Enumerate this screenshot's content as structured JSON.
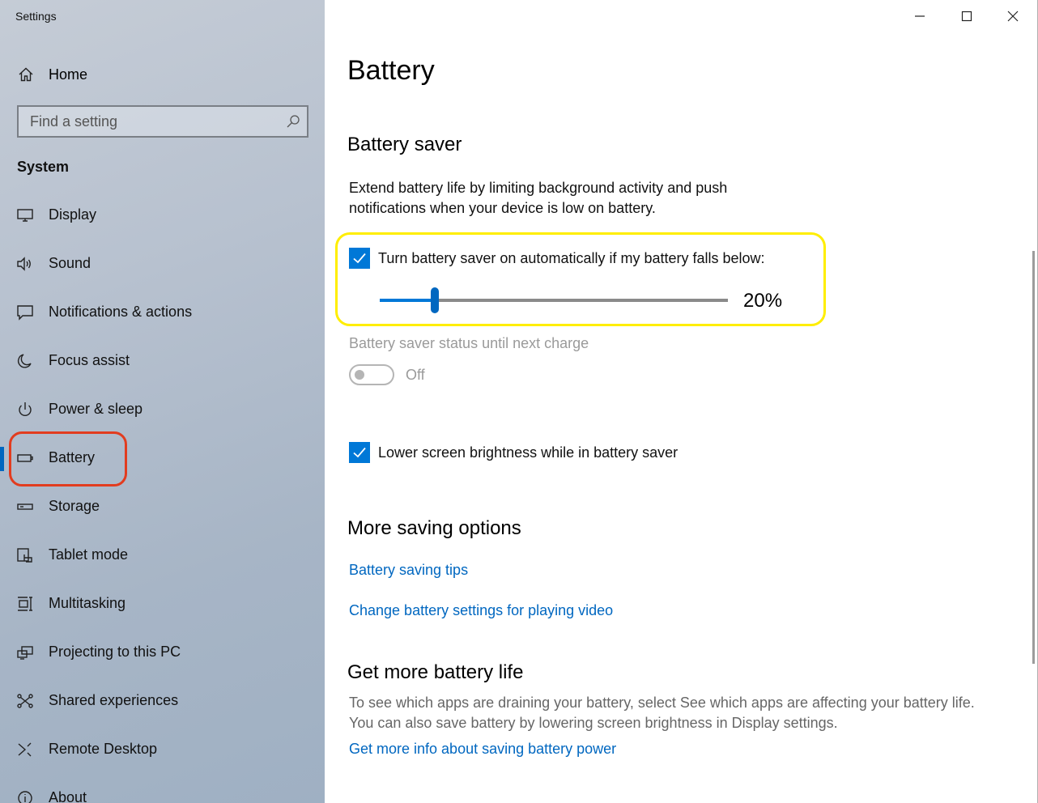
{
  "app": {
    "title": "Settings"
  },
  "sidebar": {
    "home_label": "Home",
    "search_placeholder": "Find a setting",
    "group_header": "System",
    "items": [
      {
        "label": "Display",
        "icon": "monitor-icon"
      },
      {
        "label": "Sound",
        "icon": "speaker-icon"
      },
      {
        "label": "Notifications & actions",
        "icon": "notification-icon"
      },
      {
        "label": "Focus assist",
        "icon": "moon-icon"
      },
      {
        "label": "Power & sleep",
        "icon": "power-icon"
      },
      {
        "label": "Battery",
        "icon": "battery-icon",
        "selected": true
      },
      {
        "label": "Storage",
        "icon": "storage-icon"
      },
      {
        "label": "Tablet mode",
        "icon": "tablet-mode-icon"
      },
      {
        "label": "Multitasking",
        "icon": "multitasking-icon"
      },
      {
        "label": "Projecting to this PC",
        "icon": "projecting-icon"
      },
      {
        "label": "Shared experiences",
        "icon": "shared-experiences-icon"
      },
      {
        "label": "Remote Desktop",
        "icon": "remote-desktop-icon"
      },
      {
        "label": "About",
        "icon": "info-icon"
      }
    ]
  },
  "main": {
    "title": "Battery",
    "battery_saver": {
      "heading": "Battery saver",
      "description_line1": "Extend battery life by limiting background activity and push",
      "description_line2": "notifications when your device is low on battery.",
      "auto_checkbox_label": "Turn battery saver on automatically if my battery falls below:",
      "auto_checked": true,
      "threshold_percent": 20,
      "threshold_label": "20%",
      "status_label": "Battery saver status until next charge",
      "status_toggle_label": "Off",
      "status_on": false,
      "brightness_checkbox_label": "Lower screen brightness while in battery saver",
      "brightness_checked": true
    },
    "more_saving": {
      "heading": "More saving options",
      "links": [
        "Battery saving tips",
        "Change battery settings for playing video"
      ]
    },
    "get_more": {
      "heading": "Get more battery life",
      "text_line1": "To see which apps are draining your battery, select See which apps are affecting your battery life.",
      "text_line2": "You can also save battery by lowering screen brightness in Display settings.",
      "link": "Get more info about saving battery power"
    }
  },
  "colors": {
    "accent": "#0078d7",
    "highlight_yellow": "#ffee00",
    "highlight_red": "#e23c1f",
    "link": "#0067c0"
  }
}
